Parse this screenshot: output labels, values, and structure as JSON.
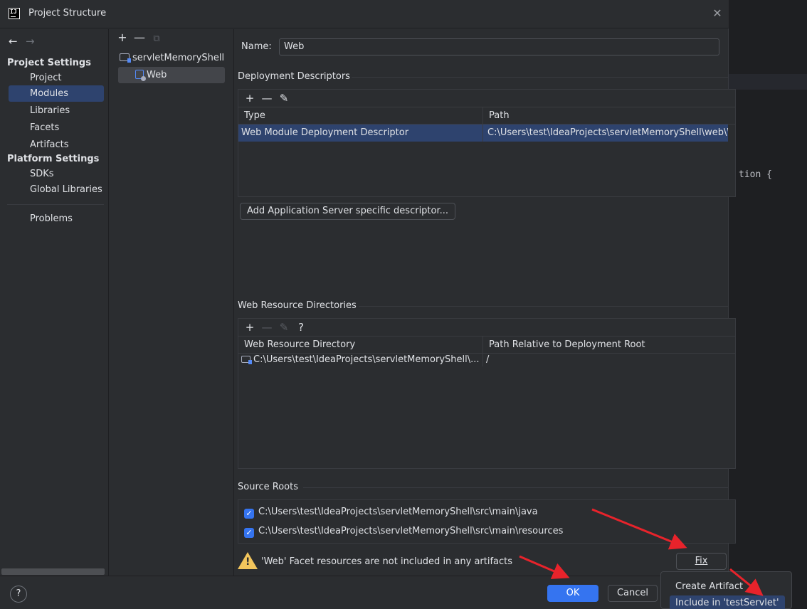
{
  "editor": {
    "code_fragment": "tion {"
  },
  "titlebar": {
    "title": "Project Structure",
    "close_icon": "close-icon",
    "logo_text": "IJ"
  },
  "nav": {
    "back": "←",
    "forward": "→",
    "project_settings": "Project Settings",
    "project_items": [
      "Project",
      "Modules",
      "Libraries",
      "Facets",
      "Artifacts"
    ],
    "platform_settings": "Platform Settings",
    "platform_items": [
      "SDKs",
      "Global Libraries"
    ],
    "problems": "Problems",
    "selected": "Modules"
  },
  "tree": {
    "toolbar": {
      "add": "+",
      "remove": "—",
      "copy": "⧉"
    },
    "root": "servletMemoryShell",
    "child": "Web"
  },
  "form": {
    "name_label": "Name:",
    "name_value": "Web"
  },
  "deployment": {
    "title": "Deployment Descriptors",
    "toolbar": {
      "add": "+",
      "remove": "—",
      "edit": "✎"
    },
    "columns": [
      "Type",
      "Path"
    ],
    "rows": [
      {
        "type": "Web Module Deployment Descriptor",
        "path": "C:\\Users\\test\\IdeaProjects\\servletMemoryShell\\web\\WEB-INF\\web.xml"
      }
    ],
    "add_button": "Add Application Server specific descriptor..."
  },
  "web_resources": {
    "title": "Web Resource Directories",
    "toolbar": {
      "add": "+",
      "remove": "—",
      "edit": "✎",
      "help": "?"
    },
    "columns": [
      "Web Resource Directory",
      "Path Relative to Deployment Root"
    ],
    "rows": [
      {
        "directory": "C:\\Users\\test\\IdeaProjects\\servletMemoryShell\\...",
        "relative": "/"
      }
    ]
  },
  "source_roots": {
    "title": "Source Roots",
    "items": [
      {
        "checked": true,
        "path": "C:\\Users\\test\\IdeaProjects\\servletMemoryShell\\src\\main\\java"
      },
      {
        "checked": true,
        "path": "C:\\Users\\test\\IdeaProjects\\servletMemoryShell\\src\\main\\resources"
      }
    ]
  },
  "warning": {
    "text": "'Web' Facet resources are not included in any artifacts",
    "fix_button": "Fix"
  },
  "footer": {
    "help": "?",
    "ok": "OK",
    "cancel": "Cancel"
  },
  "popup": {
    "items": [
      "Create Artifact",
      "Include in 'testServlet'"
    ]
  },
  "colors": {
    "accent": "#3574f0",
    "selection": "#2e436e",
    "annotation_arrow": "#e8232b",
    "warning": "#f2c55c"
  }
}
